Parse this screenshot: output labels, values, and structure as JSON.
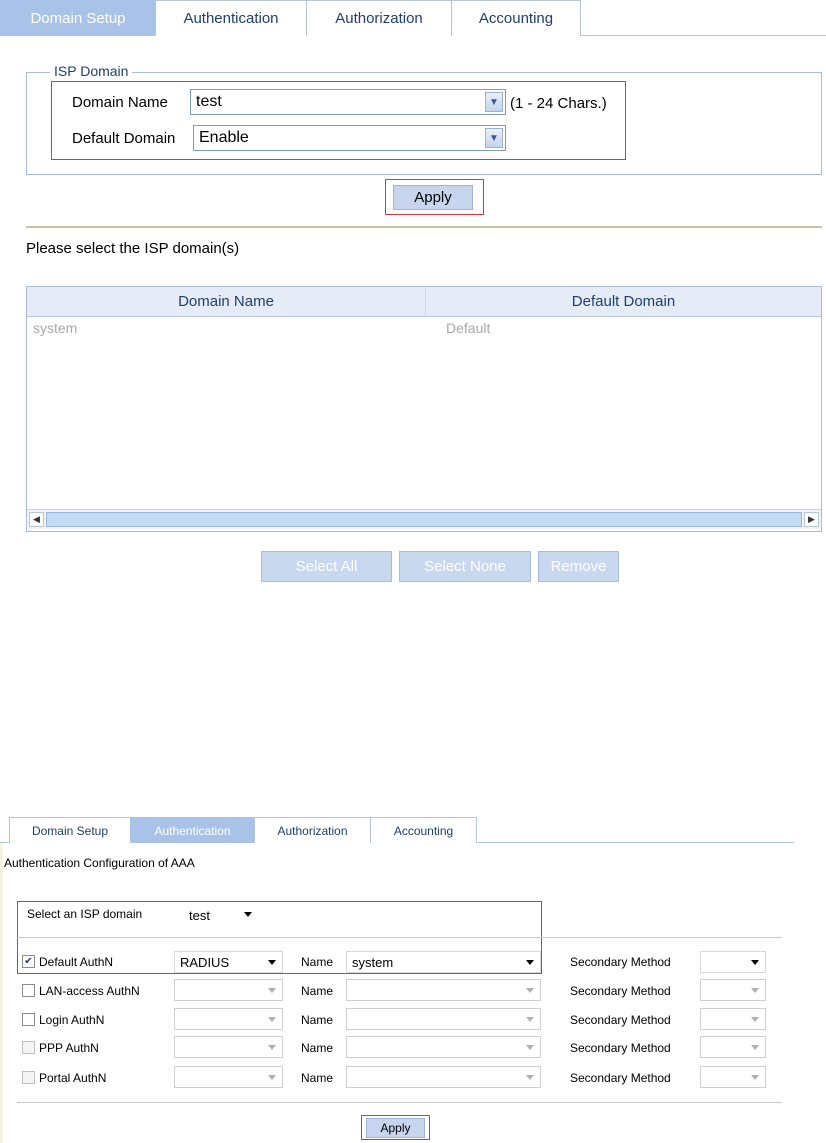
{
  "panel1": {
    "tabs": [
      {
        "label": "Domain Setup",
        "active": true
      },
      {
        "label": "Authentication",
        "active": false
      },
      {
        "label": "Authorization",
        "active": false
      },
      {
        "label": "Accounting",
        "active": false
      }
    ],
    "fieldset_legend": "ISP Domain",
    "domain_name_label": "Domain Name",
    "domain_name_value": "test",
    "domain_name_hint": "(1 - 24 Chars.)",
    "default_domain_label": "Default Domain",
    "default_domain_value": "Enable",
    "apply_label": "Apply",
    "instruction": "Please select the ISP domain(s)",
    "table": {
      "columns": [
        "Domain Name",
        "Default Domain"
      ],
      "rows": [
        [
          "system",
          "Default"
        ]
      ]
    },
    "buttons": {
      "select_all": "Select All",
      "select_none": "Select None",
      "remove": "Remove"
    }
  },
  "panel2": {
    "tabs": [
      {
        "label": "Domain Setup",
        "active": false
      },
      {
        "label": "Authentication",
        "active": true
      },
      {
        "label": "Authorization",
        "active": false
      },
      {
        "label": "Accounting",
        "active": false
      }
    ],
    "title": "Authentication Configuration of AAA",
    "select_isp_label": "Select an ISP domain",
    "select_isp_value": "test",
    "name_label": "Name",
    "secondary_label": "Secondary Method",
    "rows": [
      {
        "label": "Default AuthN",
        "checked": true,
        "enabled": true,
        "method": "RADIUS",
        "name": "system",
        "secondary": ""
      },
      {
        "label": "LAN-access AuthN",
        "checked": false,
        "enabled": true,
        "method": "",
        "name": "",
        "secondary": ""
      },
      {
        "label": "Login AuthN",
        "checked": false,
        "enabled": true,
        "method": "",
        "name": "",
        "secondary": ""
      },
      {
        "label": "PPP AuthN",
        "checked": false,
        "enabled": false,
        "method": "",
        "name": "",
        "secondary": ""
      },
      {
        "label": "Portal AuthN",
        "checked": false,
        "enabled": false,
        "method": "",
        "name": "",
        "secondary": ""
      }
    ],
    "apply_label": "Apply"
  },
  "colors": {
    "active_tab": "#a9c3e8",
    "tab_text": "#1f3f6e",
    "highlight_box": "#e53333",
    "button_face": "#c7d6ee"
  }
}
